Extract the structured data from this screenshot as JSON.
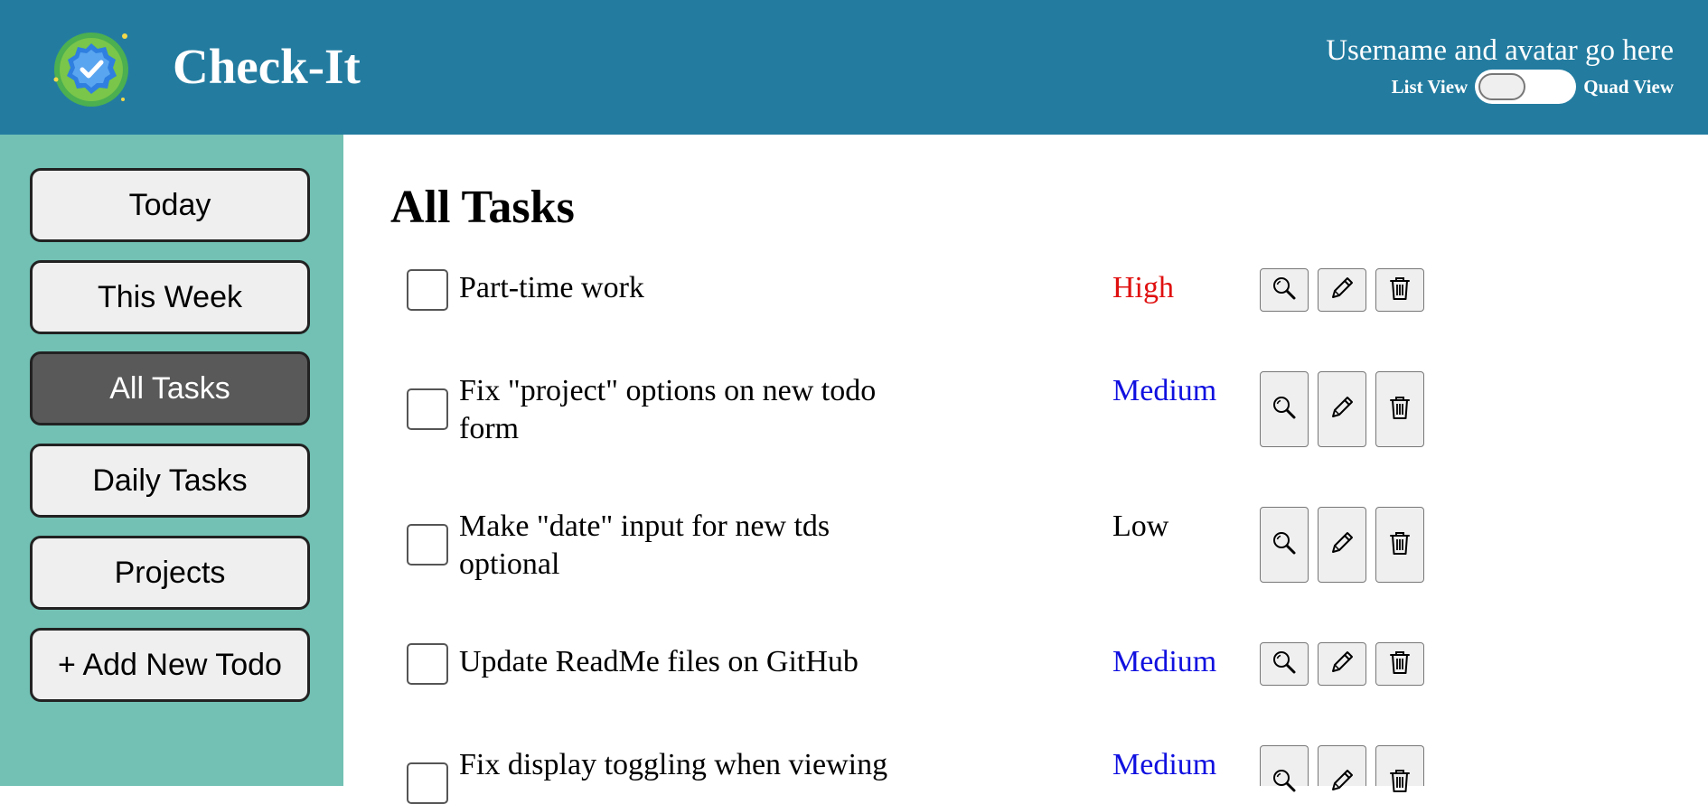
{
  "header": {
    "app_title": "Check-It",
    "user_text": "Username and avatar go here",
    "view_toggle": {
      "left_label": "List View",
      "right_label": "Quad View",
      "selected": "List View"
    }
  },
  "sidebar": {
    "items": [
      {
        "label": "Today",
        "active": false
      },
      {
        "label": "This Week",
        "active": false
      },
      {
        "label": "All Tasks",
        "active": true
      },
      {
        "label": "Daily Tasks",
        "active": false
      },
      {
        "label": "Projects",
        "active": false
      },
      {
        "label": "+ Add New Todo",
        "active": false
      }
    ]
  },
  "main": {
    "title": "All Tasks",
    "tasks": [
      {
        "name": "Part-time work",
        "priority": "High",
        "checked": false
      },
      {
        "name": "Fix \"project\" options on new todo form",
        "priority": "Medium",
        "checked": false
      },
      {
        "name": "Make \"date\" input for new tds optional",
        "priority": "Low",
        "checked": false
      },
      {
        "name": "Update ReadMe files on GitHub",
        "priority": "Medium",
        "checked": false
      },
      {
        "name": "Fix display toggling when viewing",
        "priority": "Medium",
        "checked": false
      }
    ]
  },
  "icons": {
    "task_actions": [
      "magnifier-icon",
      "pencil-icon",
      "trash-icon"
    ],
    "logo": "badge-check-logo"
  },
  "colors": {
    "header_bg": "#237ca0",
    "sidebar_bg": "#72c1b4",
    "active_nav_bg": "#595959",
    "priority_high": "#e01010",
    "priority_medium": "#1010e0",
    "priority_low": "#000000"
  }
}
